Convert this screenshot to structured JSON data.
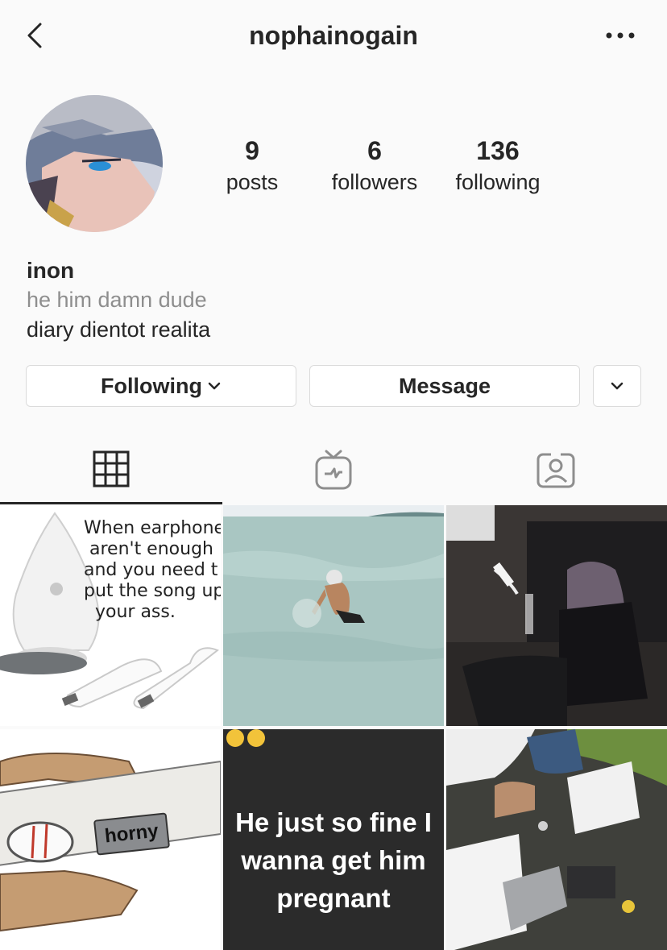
{
  "header": {
    "username": "nophainogain"
  },
  "profile": {
    "stats": [
      {
        "value": "9",
        "label": "posts"
      },
      {
        "value": "6",
        "label": "followers"
      },
      {
        "value": "136",
        "label": "following"
      }
    ],
    "name": "inon",
    "pronouns": "he him damn dude",
    "bio": "diary dientot realita"
  },
  "actions": {
    "following_label": "Following",
    "message_label": "Message"
  },
  "tabs": [
    "grid-icon",
    "igtv-icon",
    "tagged-icon"
  ],
  "posts": [
    {
      "text": "When earphones\n aren't enough\nand you need t\nput the song up\n  your ass."
    },
    {
      "text": ""
    },
    {
      "text": ""
    },
    {
      "text": "horny"
    },
    {
      "text": "He just so fine I wanna get him pregnant"
    },
    {
      "text": ""
    }
  ]
}
